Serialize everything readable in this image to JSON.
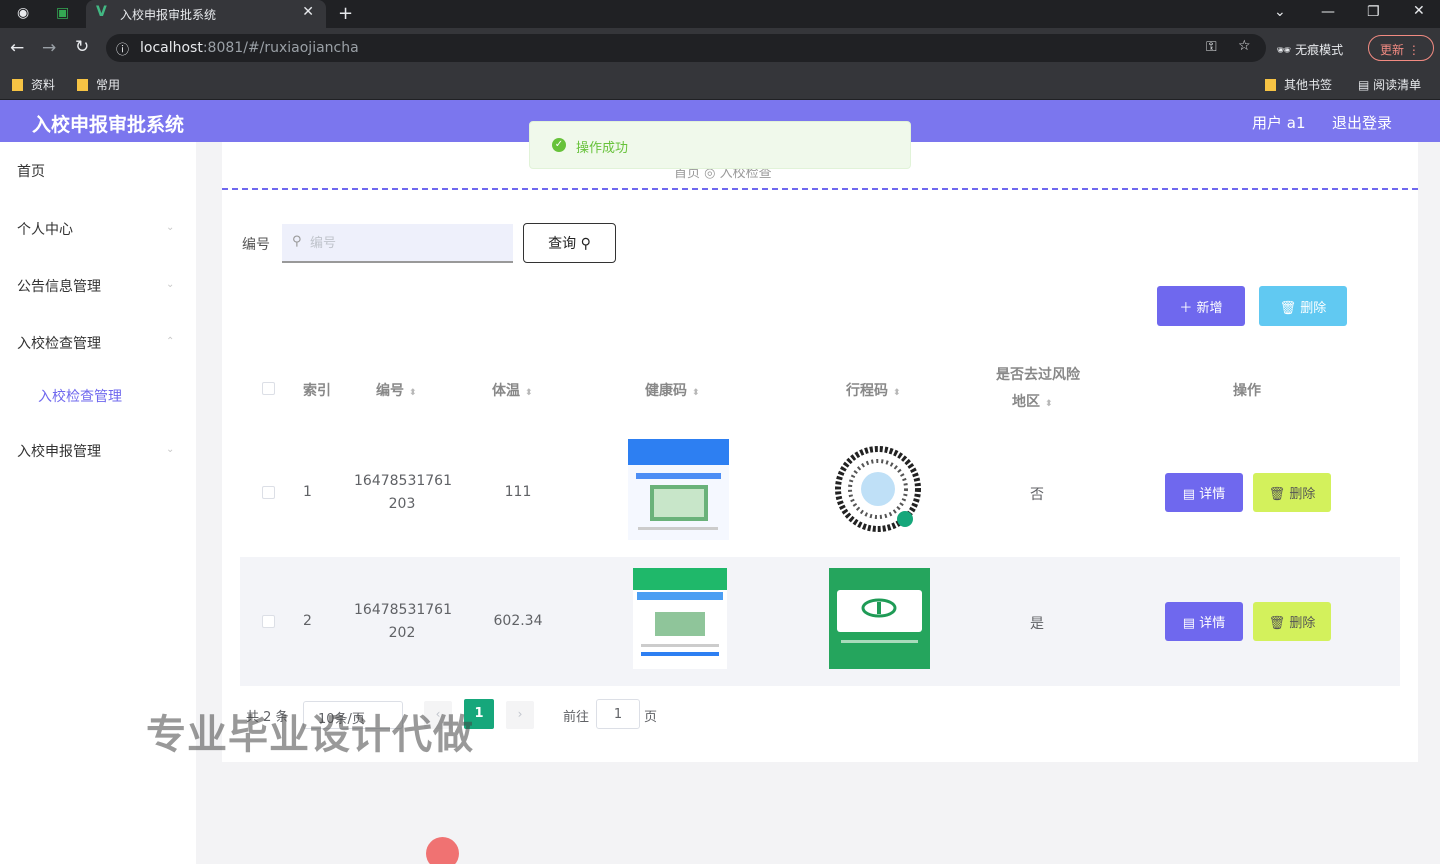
{
  "browser": {
    "tab_title": "入校申报审批系统",
    "url_host": "localhost",
    "url_rest": ":8081/#/ruxiaojiancha",
    "incognito": "无痕模式",
    "update": "更新",
    "bookmarks": [
      "资料",
      "常用"
    ],
    "other_bookmarks": "其他书签",
    "reading_list": "阅读清单"
  },
  "app": {
    "title": "入校申报审批系统",
    "user": "用户 a1",
    "logout": "退出登录"
  },
  "toast": {
    "message": "操作成功"
  },
  "sidebar": {
    "items": [
      {
        "label": "首页"
      },
      {
        "label": "个人中心"
      },
      {
        "label": "公告信息管理"
      },
      {
        "label": "入校检查管理"
      },
      {
        "label": "入校检查管理"
      },
      {
        "label": "入校申报管理"
      }
    ]
  },
  "breadcrumb": "首页 ◎ 入校检查",
  "search": {
    "label": "编号",
    "placeholder": "编号",
    "button": "查询 ⚲"
  },
  "actions": {
    "add": "＋ 新增",
    "delete": "🗑 删除"
  },
  "table": {
    "headers": {
      "index": "索引",
      "id": "编号",
      "temp": "体温",
      "health": "健康码",
      "trip": "行程码",
      "risk1": "是否去过风险",
      "risk2": "地区",
      "ops": "操作"
    },
    "rows": [
      {
        "index": "1",
        "id1": "16478531761",
        "id2": "203",
        "temp": "111",
        "risk": "否",
        "detail": "详情",
        "delete": "删除"
      },
      {
        "index": "2",
        "id1": "16478531761",
        "id2": "202",
        "temp": "602.34",
        "risk": "是",
        "detail": "详情",
        "delete": "删除"
      }
    ]
  },
  "pager": {
    "total": "共 2 条",
    "size": "10条/页",
    "current": "1",
    "goto": "前往",
    "jump": "1",
    "page": "页"
  },
  "watermark": "专业毕业设计代做"
}
